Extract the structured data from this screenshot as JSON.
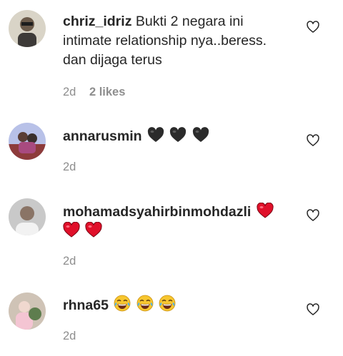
{
  "comments": [
    {
      "username": "chriz_idriz",
      "text": "Bukti 2 negara ini intimate relationship nya..beress. dan dijaga terus",
      "time": "2d",
      "likes": "2 likes",
      "emoji": ""
    },
    {
      "username": "annarusmin",
      "text": "",
      "time": "2d",
      "likes": "",
      "emoji": "black-heart x3"
    },
    {
      "username": "mohamadsyahirbinmohdazli",
      "text": "",
      "time": "2d",
      "likes": "",
      "emoji": "red-heart x3"
    },
    {
      "username": "rhna65",
      "text": "",
      "time": "2d",
      "likes": "",
      "emoji": "tears-of-joy x3"
    }
  ],
  "colors": {
    "text": "#262626",
    "muted": "#8e8e8e",
    "black_heart": "#2b2b2b",
    "red_heart": "#e0102a",
    "laugh_face": "#f7c62f"
  }
}
